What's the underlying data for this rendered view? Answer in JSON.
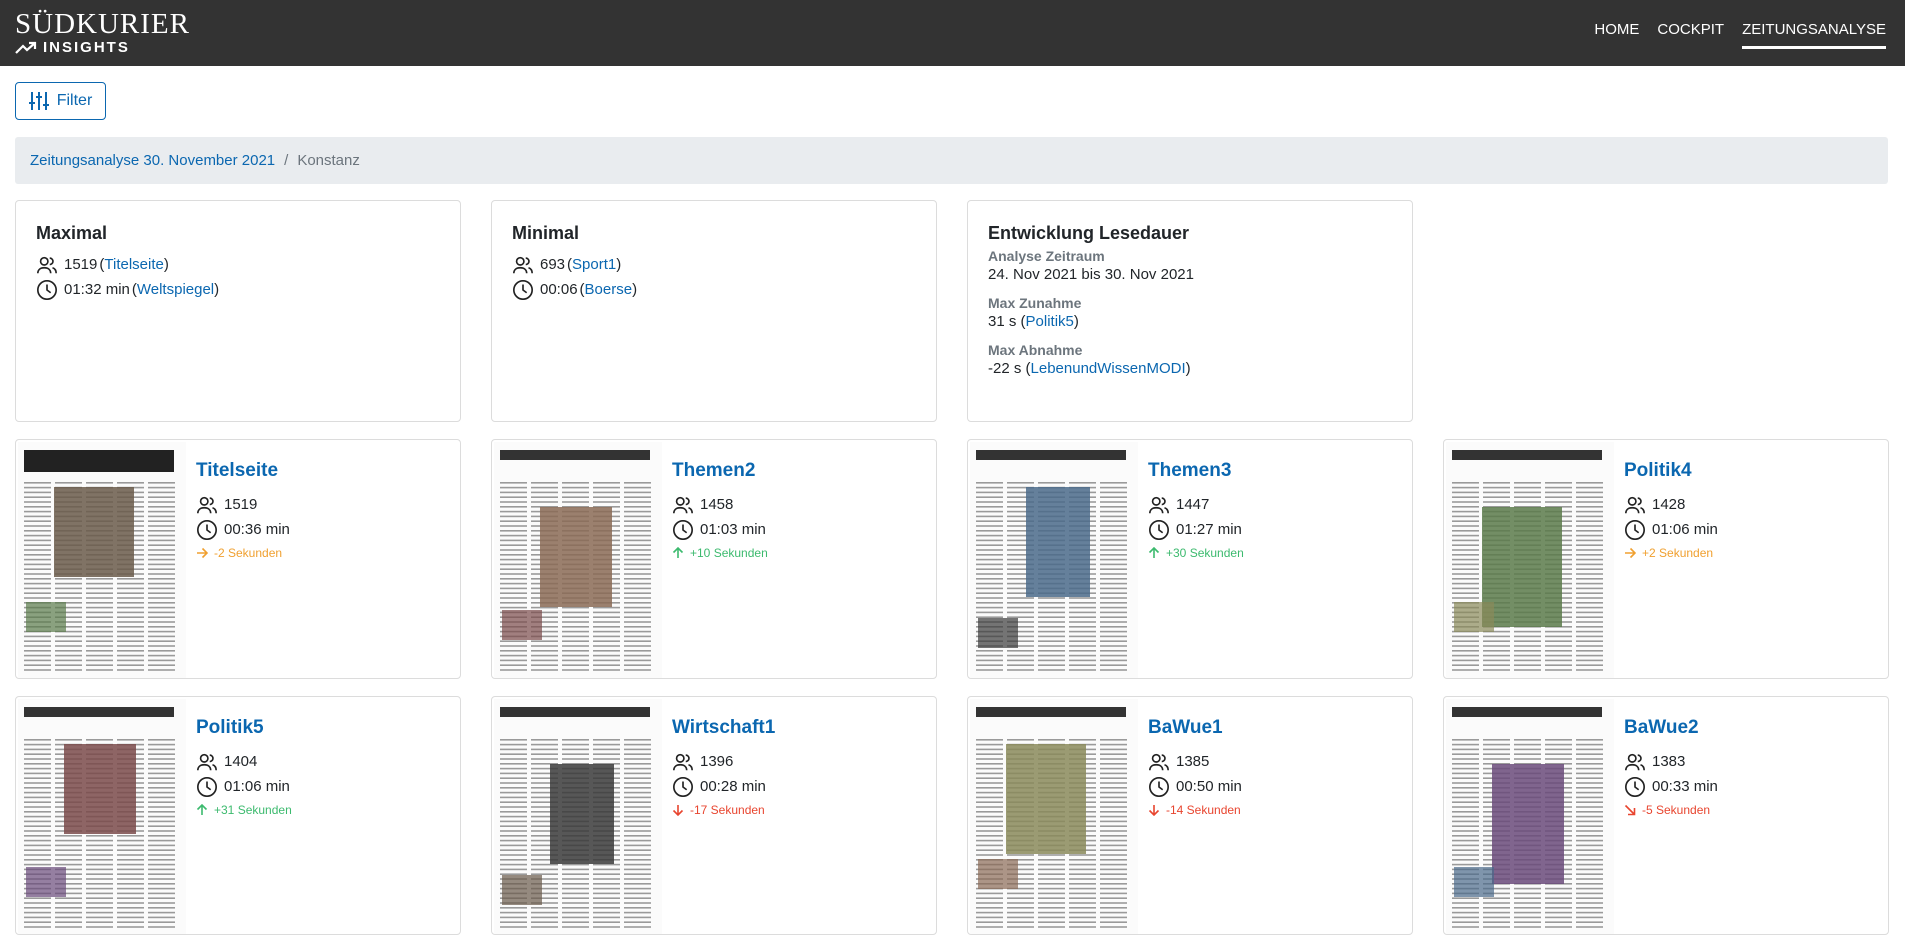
{
  "header": {
    "logo_main": "SÜDKURIER",
    "logo_sub": "INSIGHTS",
    "nav": [
      {
        "label": "HOME"
      },
      {
        "label": "COCKPIT"
      },
      {
        "label": "ZEITUNGSANALYSE"
      }
    ]
  },
  "filter": {
    "label": "Filter"
  },
  "breadcrumb": {
    "link": "Zeitungsanalyse 30. November 2021",
    "separator": "/",
    "current": "Konstanz"
  },
  "summary": {
    "maximal": {
      "title": "Maximal",
      "readers": "1519",
      "readers_page": "Titelseite",
      "duration": "01:32 min",
      "duration_page": "Weltspiegel"
    },
    "minimal": {
      "title": "Minimal",
      "readers": "693",
      "readers_page": "Sport1",
      "duration": "00:06",
      "duration_page": "Boerse"
    },
    "entwicklung": {
      "title": "Entwicklung Lesedauer",
      "zeitraum_label": "Analyse Zeitraum",
      "zeitraum_value": "24. Nov 2021 bis 30. Nov 2021",
      "zunahme_label": "Max Zunahme",
      "zunahme_value": "31 s",
      "zunahme_page": "Politik5",
      "abnahme_label": "Max Abnahme",
      "abnahme_value": "-22 s",
      "abnahme_page": "LebenundWissenMODI"
    }
  },
  "pages": [
    {
      "title": "Titelseite",
      "readers": "1519",
      "duration": "00:36 min",
      "trend": "-2 Sekunden",
      "trend_dir": "right",
      "trend_color": "#f0a030"
    },
    {
      "title": "Themen2",
      "readers": "1458",
      "duration": "01:03 min",
      "trend": "+10 Sekunden",
      "trend_dir": "up",
      "trend_color": "#3cba6e"
    },
    {
      "title": "Themen3",
      "readers": "1447",
      "duration": "01:27 min",
      "trend": "+30 Sekunden",
      "trend_dir": "up",
      "trend_color": "#3cba6e"
    },
    {
      "title": "Politik4",
      "readers": "1428",
      "duration": "01:06 min",
      "trend": "+2 Sekunden",
      "trend_dir": "right",
      "trend_color": "#f0a030"
    },
    {
      "title": "Politik5",
      "readers": "1404",
      "duration": "01:06 min",
      "trend": "+31 Sekunden",
      "trend_dir": "up",
      "trend_color": "#3cba6e"
    },
    {
      "title": "Wirtschaft1",
      "readers": "1396",
      "duration": "00:28 min",
      "trend": "-17 Sekunden",
      "trend_dir": "down",
      "trend_color": "#e8452f"
    },
    {
      "title": "BaWue1",
      "readers": "1385",
      "duration": "00:50 min",
      "trend": "-14 Sekunden",
      "trend_dir": "down",
      "trend_color": "#e8452f"
    },
    {
      "title": "BaWue2",
      "readers": "1383",
      "duration": "00:33 min",
      "trend": "-5 Sekunden",
      "trend_dir": "down-right",
      "trend_color": "#e8452f"
    }
  ]
}
